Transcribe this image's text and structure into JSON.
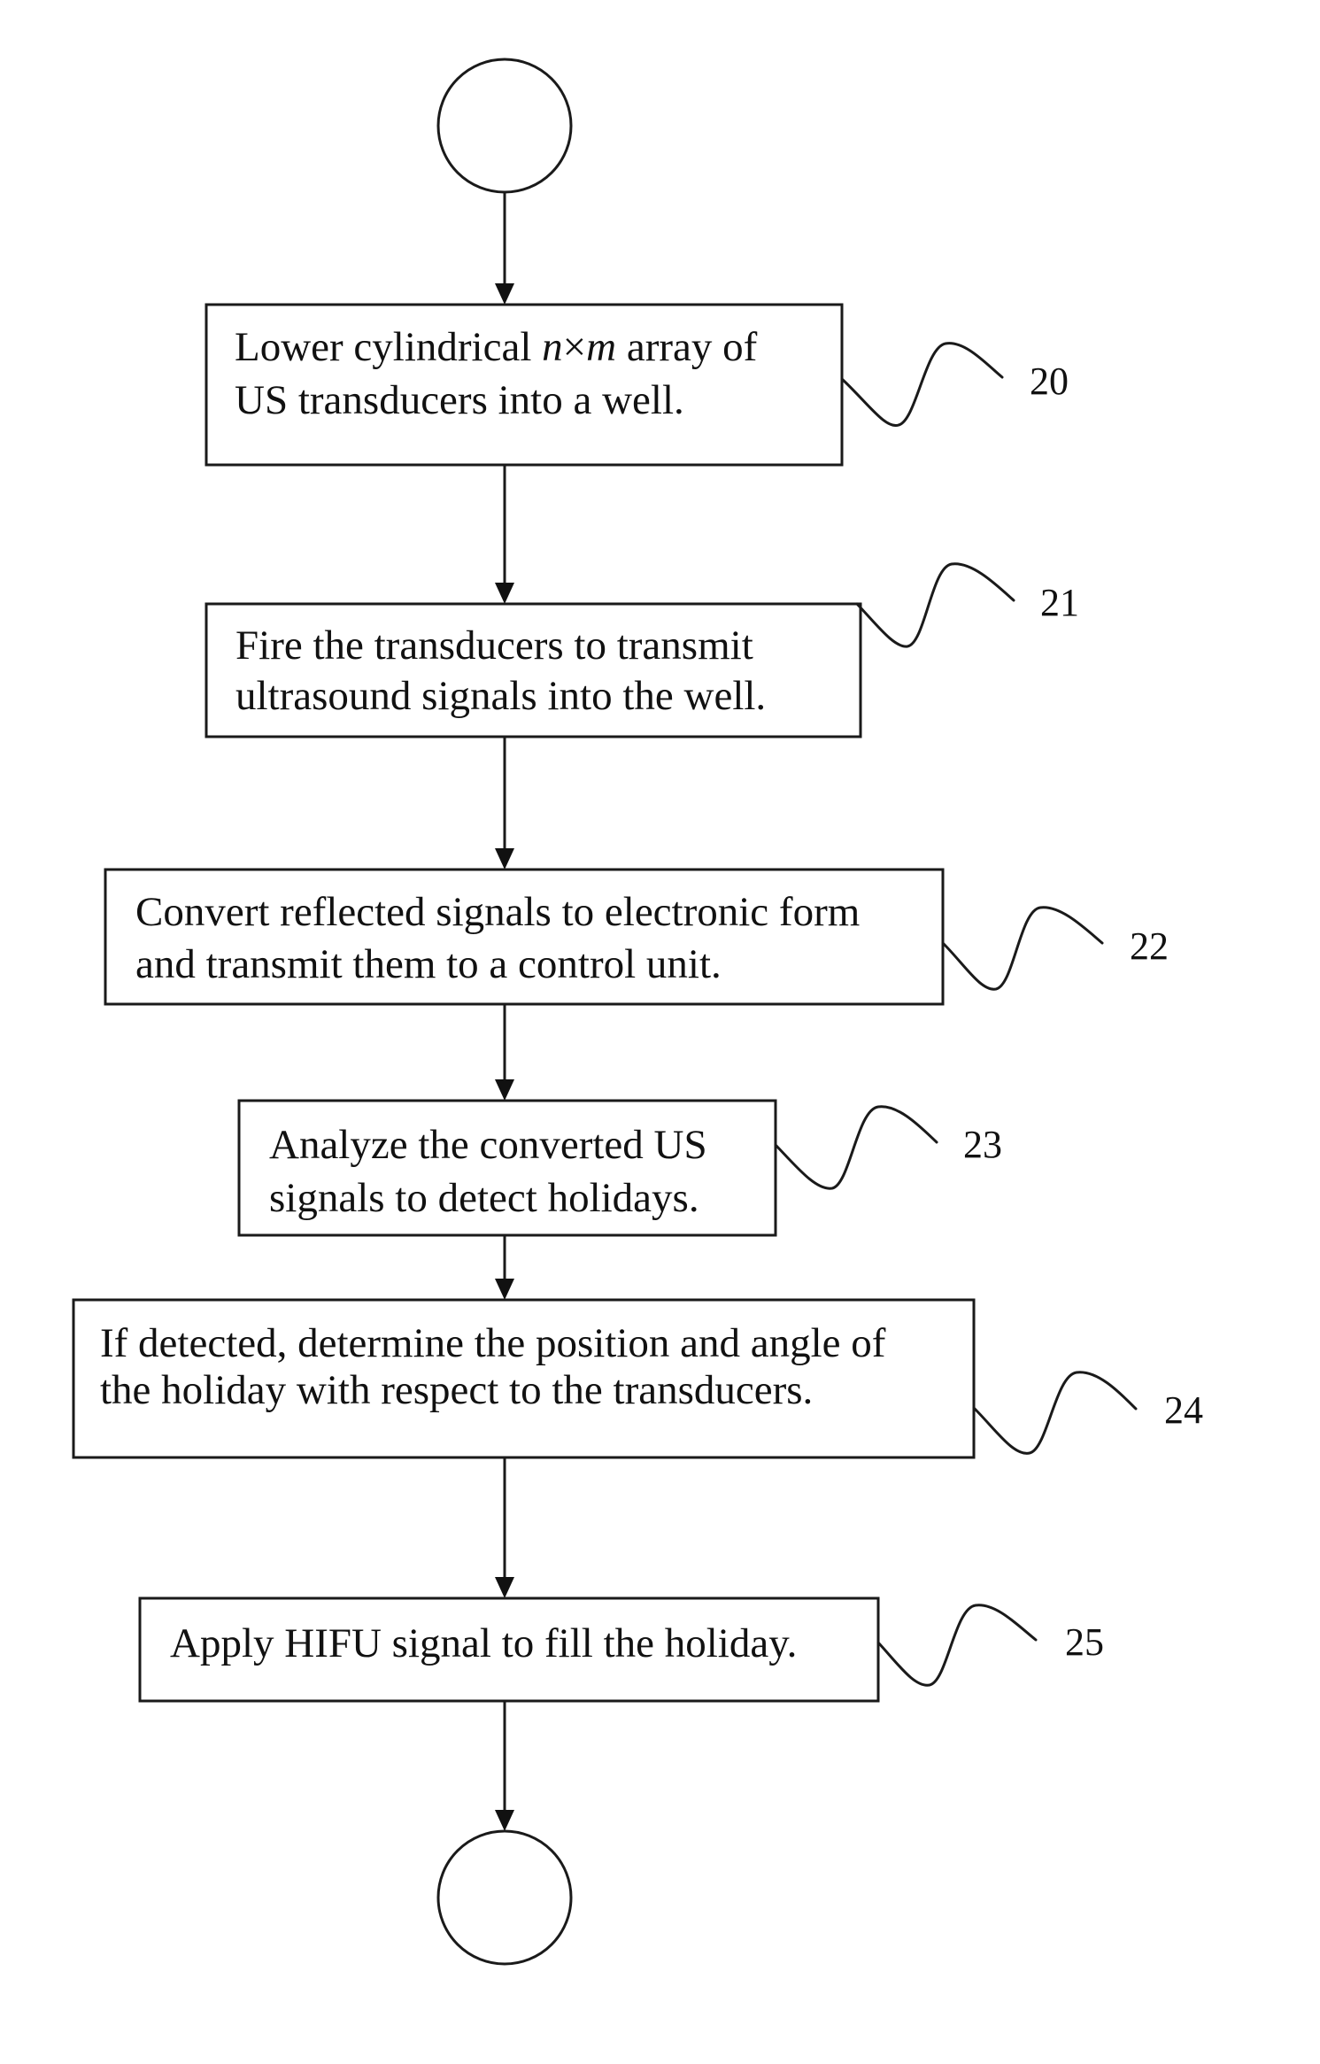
{
  "diagram": {
    "type": "flowchart",
    "start": {
      "label": ""
    },
    "end": {
      "label": ""
    },
    "steps": [
      {
        "ref": "20",
        "lines": [
          [
            {
              "text": "Lower cylindrical "
            },
            {
              "text": "n",
              "italic": true
            },
            {
              "text": "×"
            },
            {
              "text": "m",
              "italic": true
            },
            {
              "text": " array of"
            }
          ],
          [
            {
              "text": "US transducers into a well."
            }
          ]
        ]
      },
      {
        "ref": "21",
        "lines": [
          [
            {
              "text": "Fire the transducers to transmit"
            }
          ],
          [
            {
              "text": "ultrasound signals into the well."
            }
          ]
        ]
      },
      {
        "ref": "22",
        "lines": [
          [
            {
              "text": "Convert reflected signals to electronic form"
            }
          ],
          [
            {
              "text": "and transmit them to a control unit."
            }
          ]
        ]
      },
      {
        "ref": "23",
        "lines": [
          [
            {
              "text": "Analyze the converted US"
            }
          ],
          [
            {
              "text": "signals to detect holidays."
            }
          ]
        ]
      },
      {
        "ref": "24",
        "lines": [
          [
            {
              "text": "If detected, determine the position and angle of"
            }
          ],
          [
            {
              "text": "the holiday with respect to the transducers."
            }
          ]
        ]
      },
      {
        "ref": "25",
        "lines": [
          [
            {
              "text": "Apply HIFU signal to fill the holiday."
            }
          ]
        ]
      }
    ]
  }
}
